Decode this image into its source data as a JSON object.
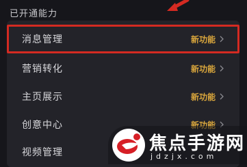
{
  "section": {
    "title": "已开通能力"
  },
  "features": [
    {
      "label": "消息管理",
      "status": "新功能",
      "highlighted": true
    },
    {
      "label": "营销转化",
      "status": "新功能"
    },
    {
      "label": "主页展示",
      "status": "新功能"
    },
    {
      "label": "创意中心",
      "status": "新功能"
    },
    {
      "label": "视频管理",
      "status": ""
    }
  ],
  "watermark": {
    "title": "焦点手游网",
    "subtitle": "jdzjx.com"
  },
  "colors": {
    "background": "#16161b",
    "panel": "#232329",
    "status_text": "#d9a63c",
    "highlight_border": "#d42a22"
  }
}
